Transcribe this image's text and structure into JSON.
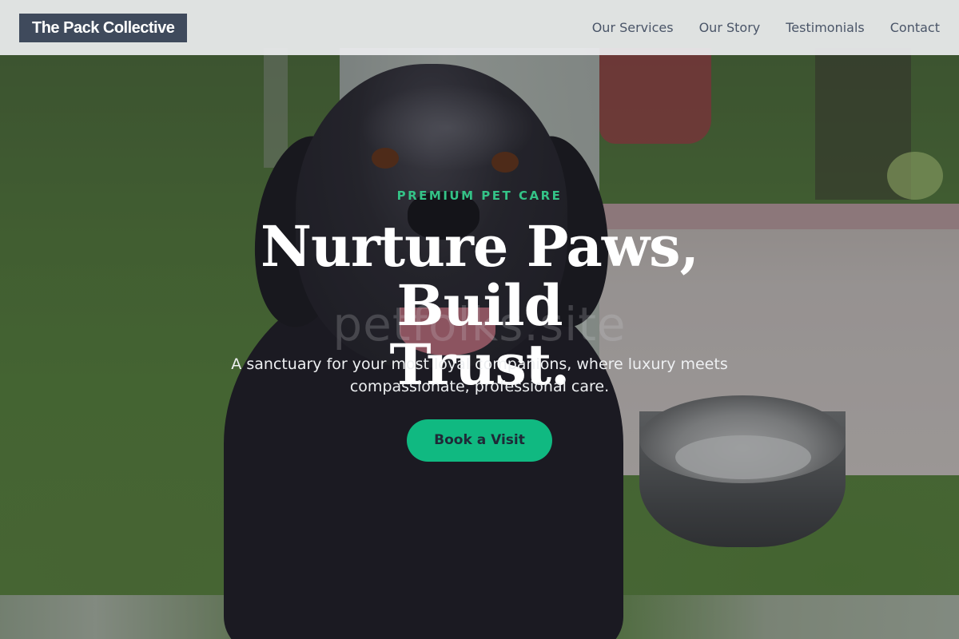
{
  "nav": {
    "brand": "The Pack Collective",
    "links": [
      "Our Services",
      "Our Story",
      "Testimonials",
      "Contact"
    ]
  },
  "hero": {
    "eyebrow": "PREMIUM PET CARE",
    "headline_line1": "Nurture Paws, Build",
    "headline_line2": "Trust.",
    "subtext": "A sanctuary for your most loyal companions, where luxury meets compassionate, professional care.",
    "cta": "Book a Visit",
    "watermark": "petfolks.site"
  },
  "colors": {
    "accent": "#10b981",
    "eyebrow": "#34c387",
    "brand_bg": "#3f4a5c",
    "nav_text": "#4a5568"
  }
}
